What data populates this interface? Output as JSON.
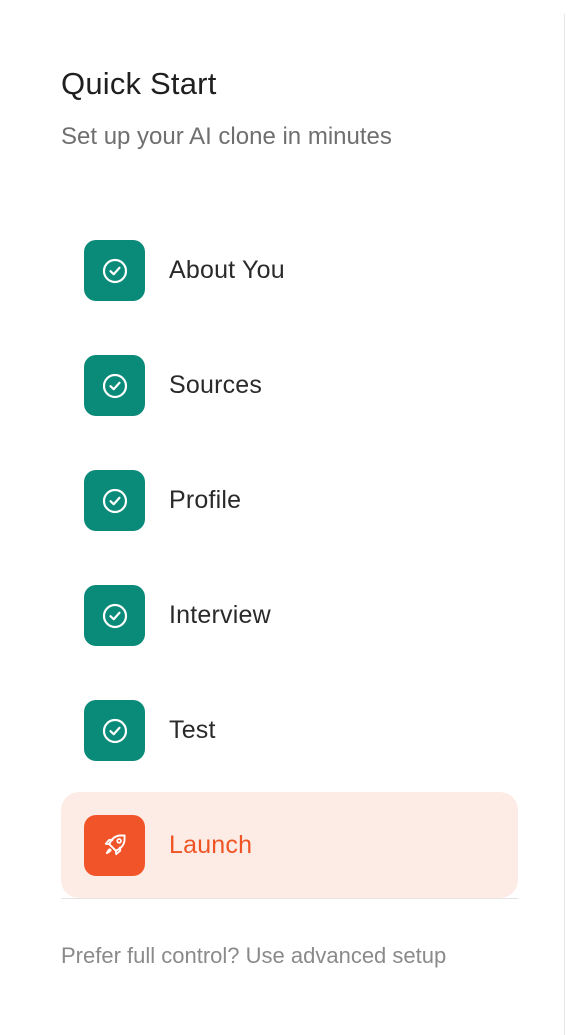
{
  "header": {
    "title": "Quick Start",
    "subtitle": "Set up your AI clone in minutes"
  },
  "steps": [
    {
      "label": "About You",
      "icon": "check-circle-icon",
      "status": "completed"
    },
    {
      "label": "Sources",
      "icon": "check-circle-icon",
      "status": "completed"
    },
    {
      "label": "Profile",
      "icon": "check-circle-icon",
      "status": "completed"
    },
    {
      "label": "Interview",
      "icon": "check-circle-icon",
      "status": "completed"
    },
    {
      "label": "Test",
      "icon": "check-circle-icon",
      "status": "completed"
    },
    {
      "label": "Launch",
      "icon": "rocket-icon",
      "status": "active"
    }
  ],
  "footer": {
    "link_text": "Prefer full control? Use advanced setup"
  },
  "colors": {
    "completed": "#0a8a78",
    "active": "#f2542a",
    "active_background": "#fdece6"
  }
}
